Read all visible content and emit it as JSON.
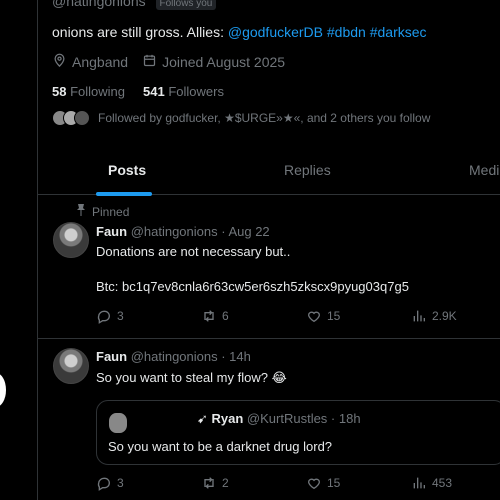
{
  "profile": {
    "handle": "@hatingonions",
    "follows_you": "Follows you",
    "bio_text": "onions are still gross. Allies: ",
    "bio_links": "@godfuckerDB #dbdn #darksec",
    "location": "Angband",
    "joined": "Joined August 2025",
    "following_count": "58",
    "following_label": "Following",
    "followers_count": "541",
    "followers_label": "Followers",
    "followed_by": "Followed by godfucker, ★$URGE»★«, and 2 others you follow"
  },
  "tabs": [
    {
      "label": "Posts"
    },
    {
      "label": "Replies"
    },
    {
      "label": "Medi"
    }
  ],
  "tweets": [
    {
      "pinned_label": "Pinned",
      "name": "Faun",
      "handle_time": "@hatingonions · Aug 22",
      "line1": "Donations are not necessary but..",
      "line2": "Btc: bc1q7ev8cnla6r63cw5er6szh5zkscx9pyug03q7g5",
      "replies": "3",
      "reposts": "6",
      "likes": "15",
      "views": "2.9K"
    },
    {
      "name": "Faun",
      "handle_time": "@hatingonions · 14h",
      "line1": "So you want to steal my flow? 😂",
      "quote": {
        "name": "➹ Ryan",
        "handle_time": "@KurtRustles · 18h",
        "text": "So you want to be a darknet drug lord?"
      },
      "replies": "3",
      "reposts": "2",
      "likes": "15",
      "views": "453"
    }
  ],
  "colors": {
    "background": "#000000",
    "accent": "#1d9bf0",
    "muted": "#71767b",
    "text": "#e7e9ea",
    "border": "#2f3336"
  }
}
